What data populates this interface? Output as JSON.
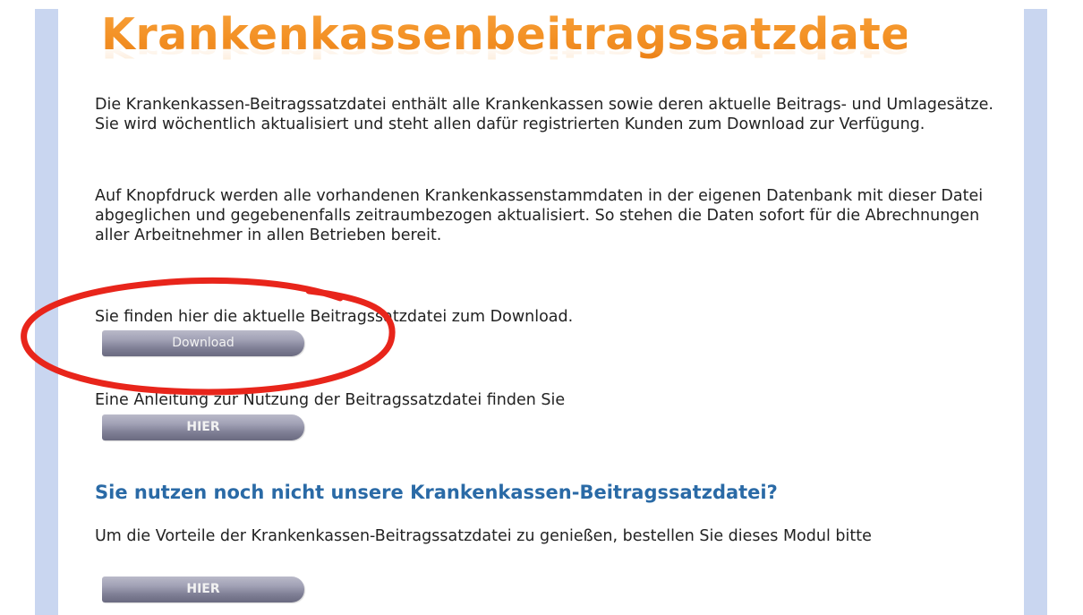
{
  "title": "Krankenkassenbeitragssatzdatei",
  "paragraphs": {
    "intro": "Die Krankenkassen-Beitragssatzdatei enthält alle Krankenkassen sowie deren aktuelle Beitrags- und Umlagesätze. Sie wird wöchentlich aktualisiert und steht allen dafür registrierten Kunden zum Download zur Verfügung.",
    "knopfdruck": "Auf Knopfdruck werden alle vorhandenen Krankenkassenstammdaten in der eigenen Datenbank mit dieser Datei abgeglichen und gegebenenfalls zeitraumbezogen aktualisiert. So stehen die Daten sofort für die Abrechnungen aller Arbeitnehmer in allen Betrieben bereit.",
    "download_hint": "Sie finden hier die aktuelle Beitragssatzdatei zum Download.",
    "anleitung_hint": "Eine Anleitung zur Nutzung der Beitragssatzdatei finden Sie",
    "bestellen_hint": "Um die Vorteile der Krankenkassen-Beitragssatzdatei zu genießen, bestellen Sie dieses Modul bitte"
  },
  "heading_not_using": "Sie nutzen noch nicht unsere Krankenkassen-Beitragssatzdatei?",
  "buttons": {
    "download": "Download",
    "anleitung": "HIER",
    "bestellen": "HIER"
  },
  "colors": {
    "title_orange": "#f39125",
    "heading_blue": "#2a6aa6",
    "side_stripe": "#c9d6f0",
    "annotation_red": "#e8251b"
  }
}
